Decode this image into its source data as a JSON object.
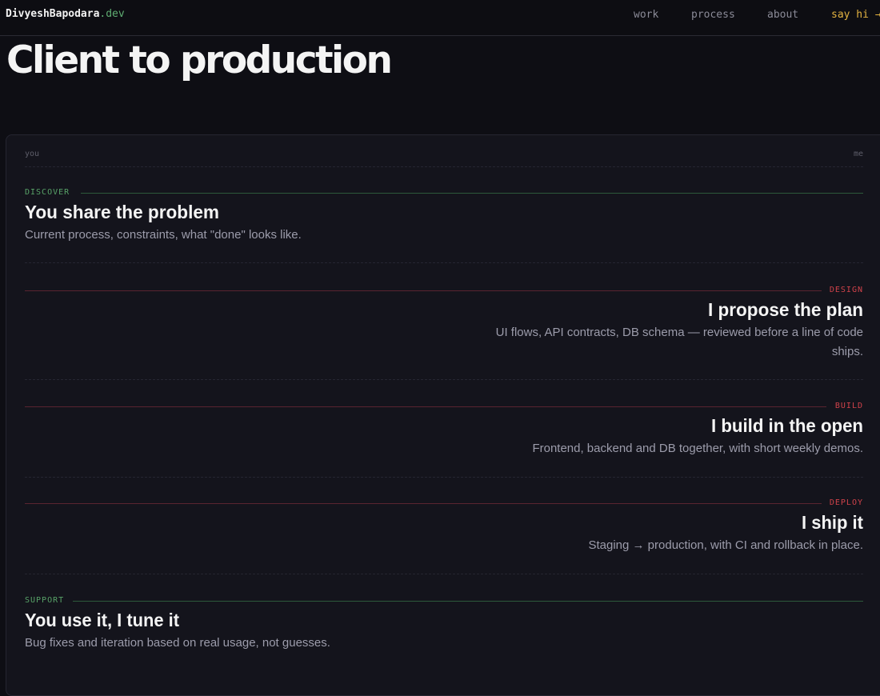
{
  "header": {
    "brand_name": "DivyeshBapodara",
    "brand_tld": ".dev",
    "nav": [
      "work",
      "process",
      "about",
      "say hi →"
    ]
  },
  "page_title": "Client to production",
  "timeline": {
    "left_label": "you",
    "right_label": "me",
    "steps": [
      {
        "tag": "DISCOVER",
        "title": "You share the problem",
        "desc": "Current process, constraints, what \"done\" looks like.",
        "side": "you"
      },
      {
        "tag": "DESIGN",
        "title": "I propose the plan",
        "desc": "UI flows, API contracts, DB schema — reviewed before a line of code ships.",
        "side": "me"
      },
      {
        "tag": "BUILD",
        "title": "I build in the open",
        "desc": "Frontend, backend and DB together, with short weekly demos.",
        "side": "me"
      },
      {
        "tag": "DEPLOY",
        "title": "I ship it",
        "desc": "Staging → production, with CI and rollback in place.",
        "side": "me"
      },
      {
        "tag": "SUPPORT",
        "title": "You use it, I tune it",
        "desc": "Bug fixes and iteration based on real usage, not guesses.",
        "side": "you"
      }
    ]
  },
  "colors": {
    "background": "#0e0e14",
    "panel": "#14141c",
    "you_accent": "#58a368",
    "me_accent": "#d0424a",
    "cta": "#e3b341"
  }
}
